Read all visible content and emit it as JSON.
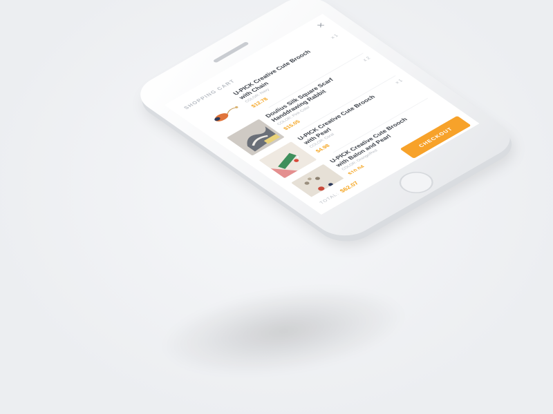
{
  "cart": {
    "title": "SHOPPING CART",
    "close_glyph": "×",
    "items": [
      {
        "name": "U-PICK Creative Cute Brooch with Chain",
        "color": "COLOR: Navy",
        "price": "$12.78",
        "qty": "x 1"
      },
      {
        "name": "Doulius Silk Square Scarf Handdrawing Rabbit",
        "color": "COLOR: Pink Color",
        "price": "$15.05",
        "qty": "x 2"
      },
      {
        "name": "U-PICK Creative Cute Brooch with Pearl",
        "color": "COLOR: Coral",
        "price": "$4.98",
        "qty": "x 1"
      },
      {
        "name": "U-PICK Creative Cute Brooch with Balon and Pearl",
        "color": "COLOR: Orange/Red",
        "price": "$10.04",
        "qty": ""
      }
    ],
    "total_label": "TOTAL:",
    "total_value": "$62.07",
    "checkout_label": "CHECKOUT"
  },
  "colors": {
    "accent": "#f7a22a",
    "price": "#f5a623"
  }
}
